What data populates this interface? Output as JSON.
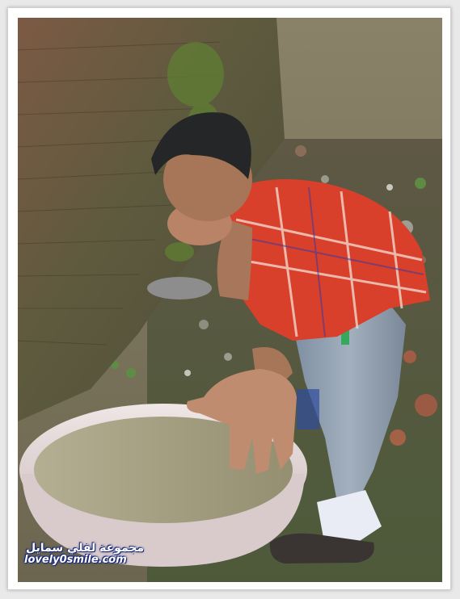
{
  "watermark": {
    "arabic": "مجموعة لفلي سمايل",
    "latin": "lovely0smile.com"
  },
  "colors": {
    "frame": "#ffffff",
    "background": "#e9e9e9",
    "shirt": "#d8402c",
    "jeans": "#8c9aa9",
    "basin": "#e2d6d6",
    "water": "#a9a487",
    "wall": "#5f5b44"
  }
}
